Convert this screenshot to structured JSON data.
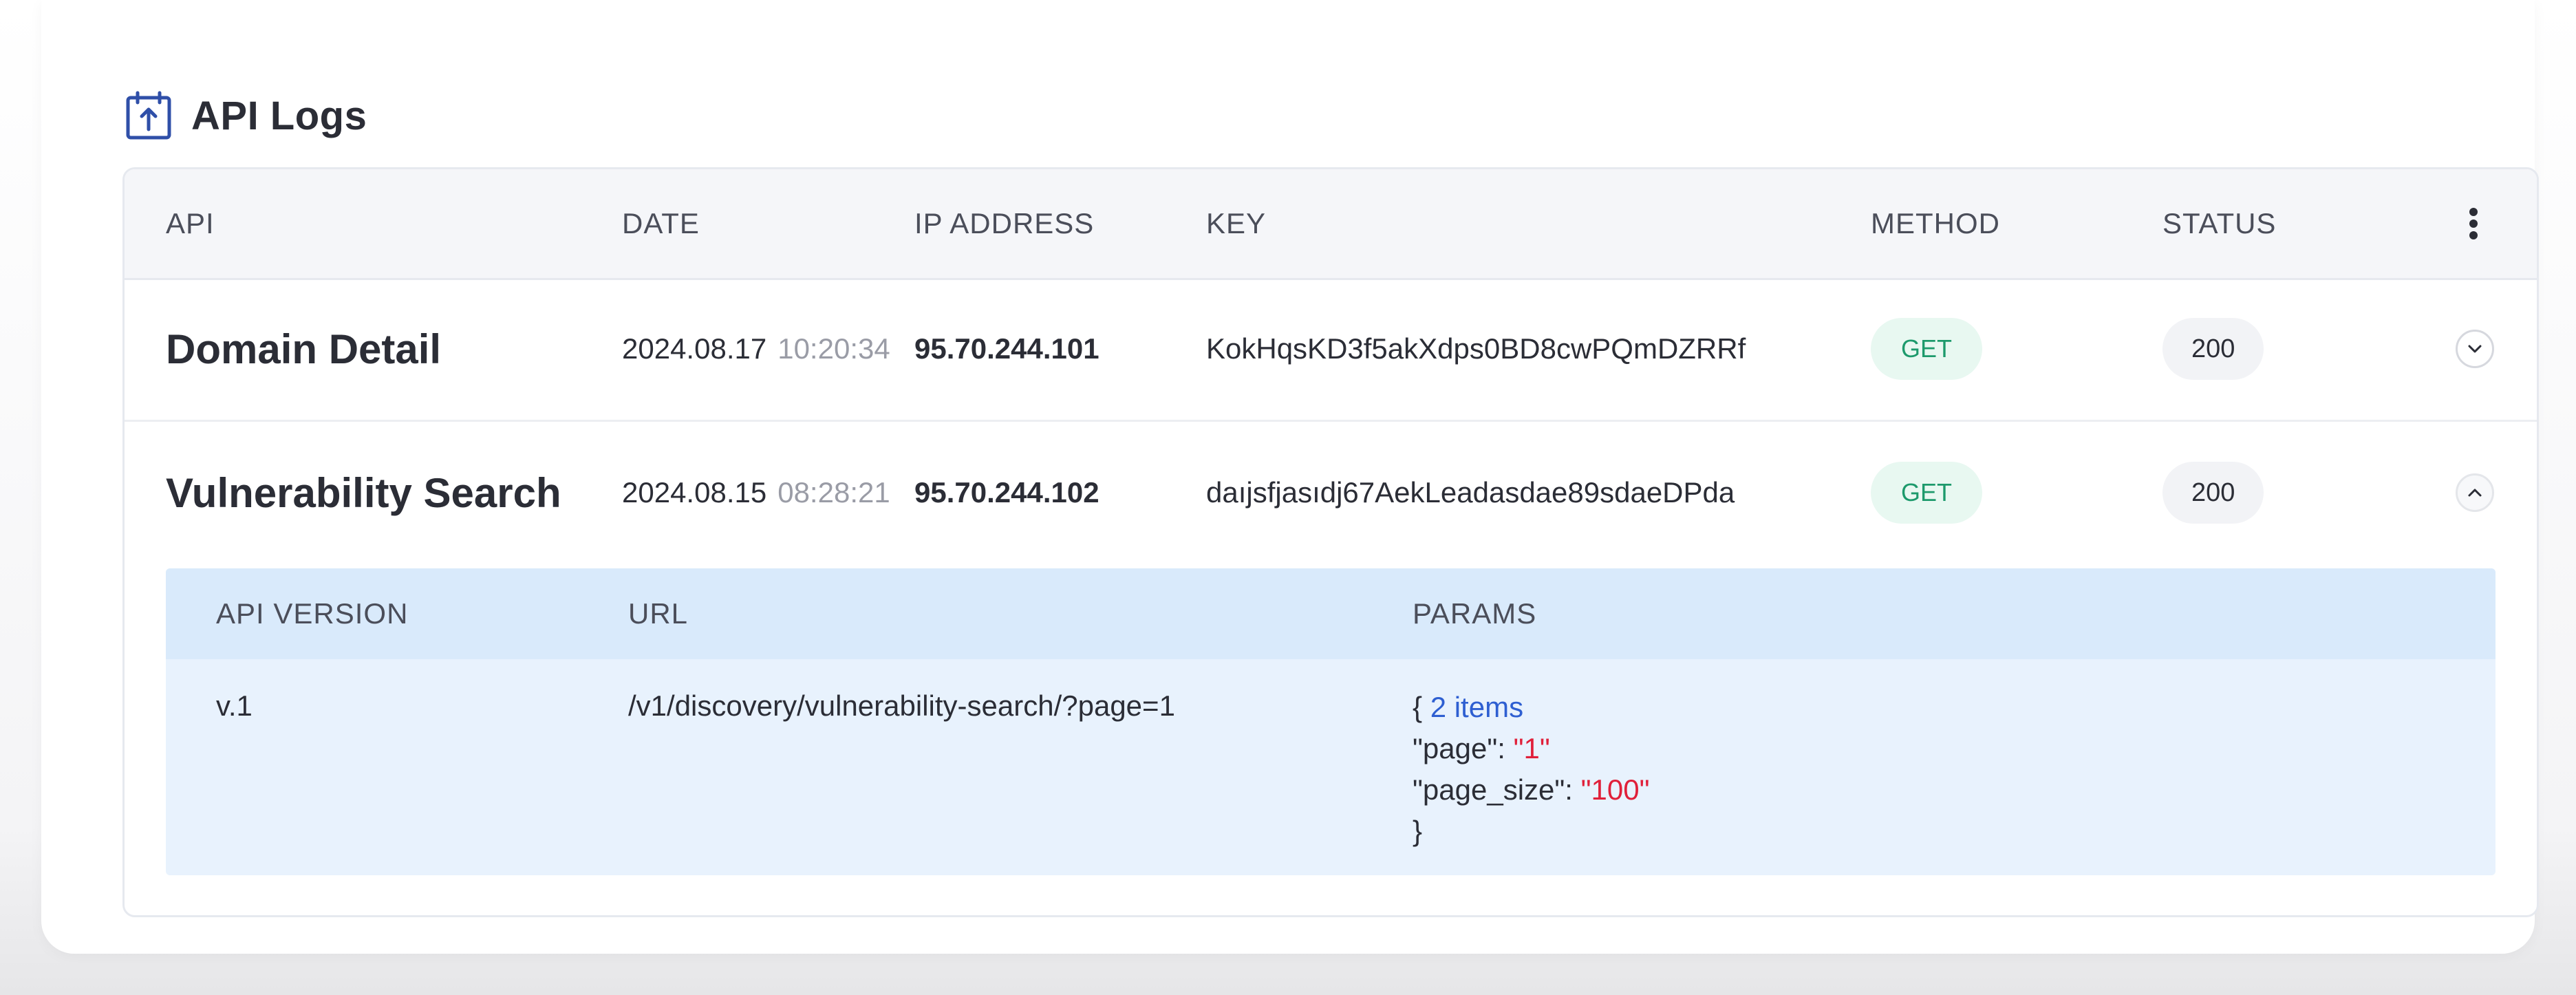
{
  "header": {
    "title": "API Logs",
    "icon": "calendar-upload-icon"
  },
  "table": {
    "columns": [
      "API",
      "DATE",
      "IP ADDRESS",
      "KEY",
      "METHOD",
      "STATUS"
    ],
    "rows": [
      {
        "api": "Domain Detail",
        "date": "2024.08.17",
        "time": "10:20:34",
        "ip": "95.70.244.101",
        "key": "KokHqsKD3f5akXdps0BD8cwPQmDZRRf",
        "method": "GET",
        "status": "200",
        "expanded": false
      },
      {
        "api": "Vulnerability Search",
        "date": "2024.08.15",
        "time": "08:28:21",
        "ip": "95.70.244.102",
        "key": "daıjsfjasıdj67AekLeadasdae89sdaeDPda",
        "method": "GET",
        "status": "200",
        "expanded": true
      }
    ],
    "detail": {
      "columns": [
        "API VERSION",
        "URL",
        "PARAMS"
      ],
      "version": "v.1",
      "url": "/v1/discovery/vulnerability-search/?page=1",
      "params": {
        "open": "{",
        "count_label": "2 items",
        "lines": [
          {
            "key": "\"page\": ",
            "value": "\"1\""
          },
          {
            "key": "\"page_size\": ",
            "value": "\"100\""
          }
        ],
        "close": "}"
      }
    }
  },
  "colors": {
    "method_bg": "#e8f8f1",
    "method_text": "#1d9a6c",
    "detail_header_bg": "#d9eafb",
    "detail_body_bg": "#e8f2fd",
    "param_count": "#2e5fd1",
    "param_string": "#e0203a"
  }
}
